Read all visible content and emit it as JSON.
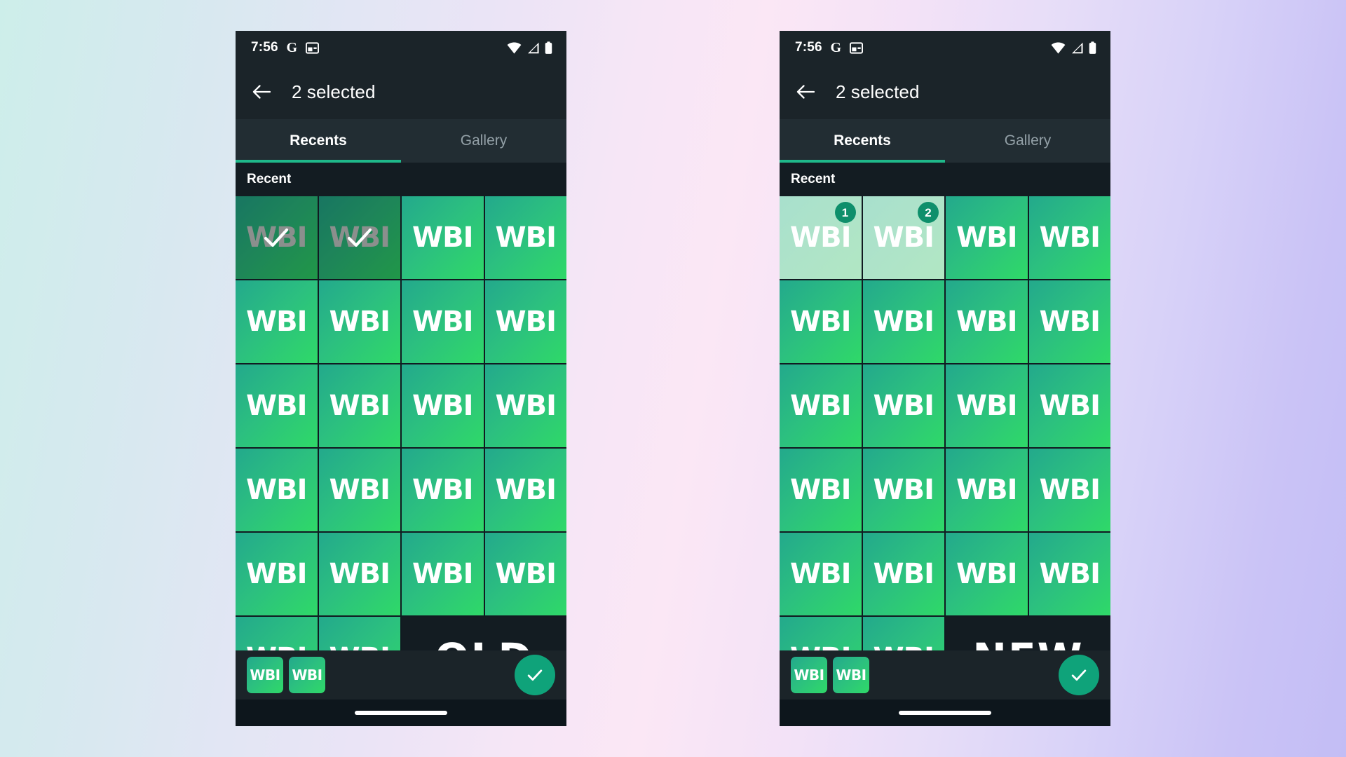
{
  "background": {
    "gradient_from": "#cdeeea",
    "gradient_mid": "#fbe7f5",
    "gradient_to": "#c3bdf5"
  },
  "theme": {
    "accent_green": "#1fb88a",
    "tile_gradient_start": "#23a98c",
    "tile_gradient_end": "#2fd968",
    "badge_color": "#0e8f6b",
    "fab_color": "#0fa37a",
    "surface_dark": "#131c22",
    "surface_bar": "#1b2429",
    "surface_tabs": "#222d33"
  },
  "status_bar": {
    "time": "7:56",
    "google_icon": "google-g-icon",
    "calendar_icon": "calendar-icon",
    "wifi_icon": "wifi-icon",
    "signal_icon": "cell-signal-icon",
    "battery_icon": "battery-icon"
  },
  "app_bar": {
    "back_icon": "back-arrow-icon",
    "title": "2 selected"
  },
  "tabs": [
    {
      "label": "Recents",
      "active": true
    },
    {
      "label": "Gallery",
      "active": false
    }
  ],
  "section": {
    "header": "Recent"
  },
  "grid": {
    "tile_label": "WBI",
    "columns": 4,
    "rows": 6,
    "tiles_per_full_row": 4,
    "last_row_tiles": 2,
    "total_tiles": 22
  },
  "variants": [
    {
      "id": "old",
      "label": "OLD",
      "selection_style": "dim-overlay-with-centered-checkmark",
      "selected_indices": [
        0,
        1
      ],
      "check_icon": "checkmark-icon"
    },
    {
      "id": "new",
      "label": "NEW",
      "selection_style": "washed-out-tile-with-numbered-badge",
      "selected_indices": [
        0,
        1
      ],
      "badges": [
        "1",
        "2"
      ]
    }
  ],
  "bottom_bar": {
    "chips": [
      {
        "label": "WBI"
      },
      {
        "label": "WBI"
      }
    ],
    "confirm_icon": "checkmark-icon",
    "confirm_label": "Confirm selection"
  },
  "nav_bar": {
    "gesture_pill": "home-gesture-pill"
  }
}
